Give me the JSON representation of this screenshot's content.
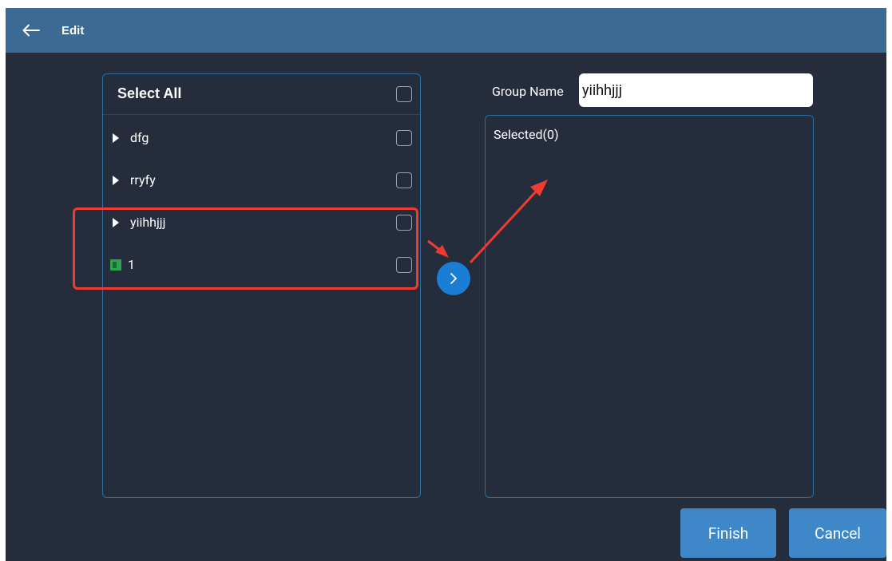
{
  "header": {
    "back_icon": "arrow-left-icon",
    "title": "Edit"
  },
  "left_panel": {
    "select_all_label": "Select All",
    "items": [
      {
        "label": "dfg",
        "type": "group",
        "icon": "triangle-right-icon",
        "checked": false
      },
      {
        "label": "rryfy",
        "type": "group",
        "icon": "triangle-right-icon",
        "checked": false
      },
      {
        "label": "yiihhjjj",
        "type": "group",
        "icon": "triangle-right-icon",
        "checked": false
      },
      {
        "label": "1",
        "type": "device",
        "icon": "device-icon",
        "checked": false
      }
    ]
  },
  "move_button": {
    "icon": "chevron-right-icon"
  },
  "right_panel": {
    "group_name_label": "Group Name",
    "group_name_value": "yiihhjjj",
    "selected_label": "Selected(0)"
  },
  "footer": {
    "finish_label": "Finish",
    "cancel_label": "Cancel"
  },
  "colors": {
    "background": "#252c3b",
    "titlebar": "#3b6a94",
    "panel_border": "#2f6fa0",
    "primary_button": "#3e87c8",
    "move_button": "#1a7ed4",
    "annotation_red": "#f03b30",
    "device_green": "#2fa54d"
  }
}
